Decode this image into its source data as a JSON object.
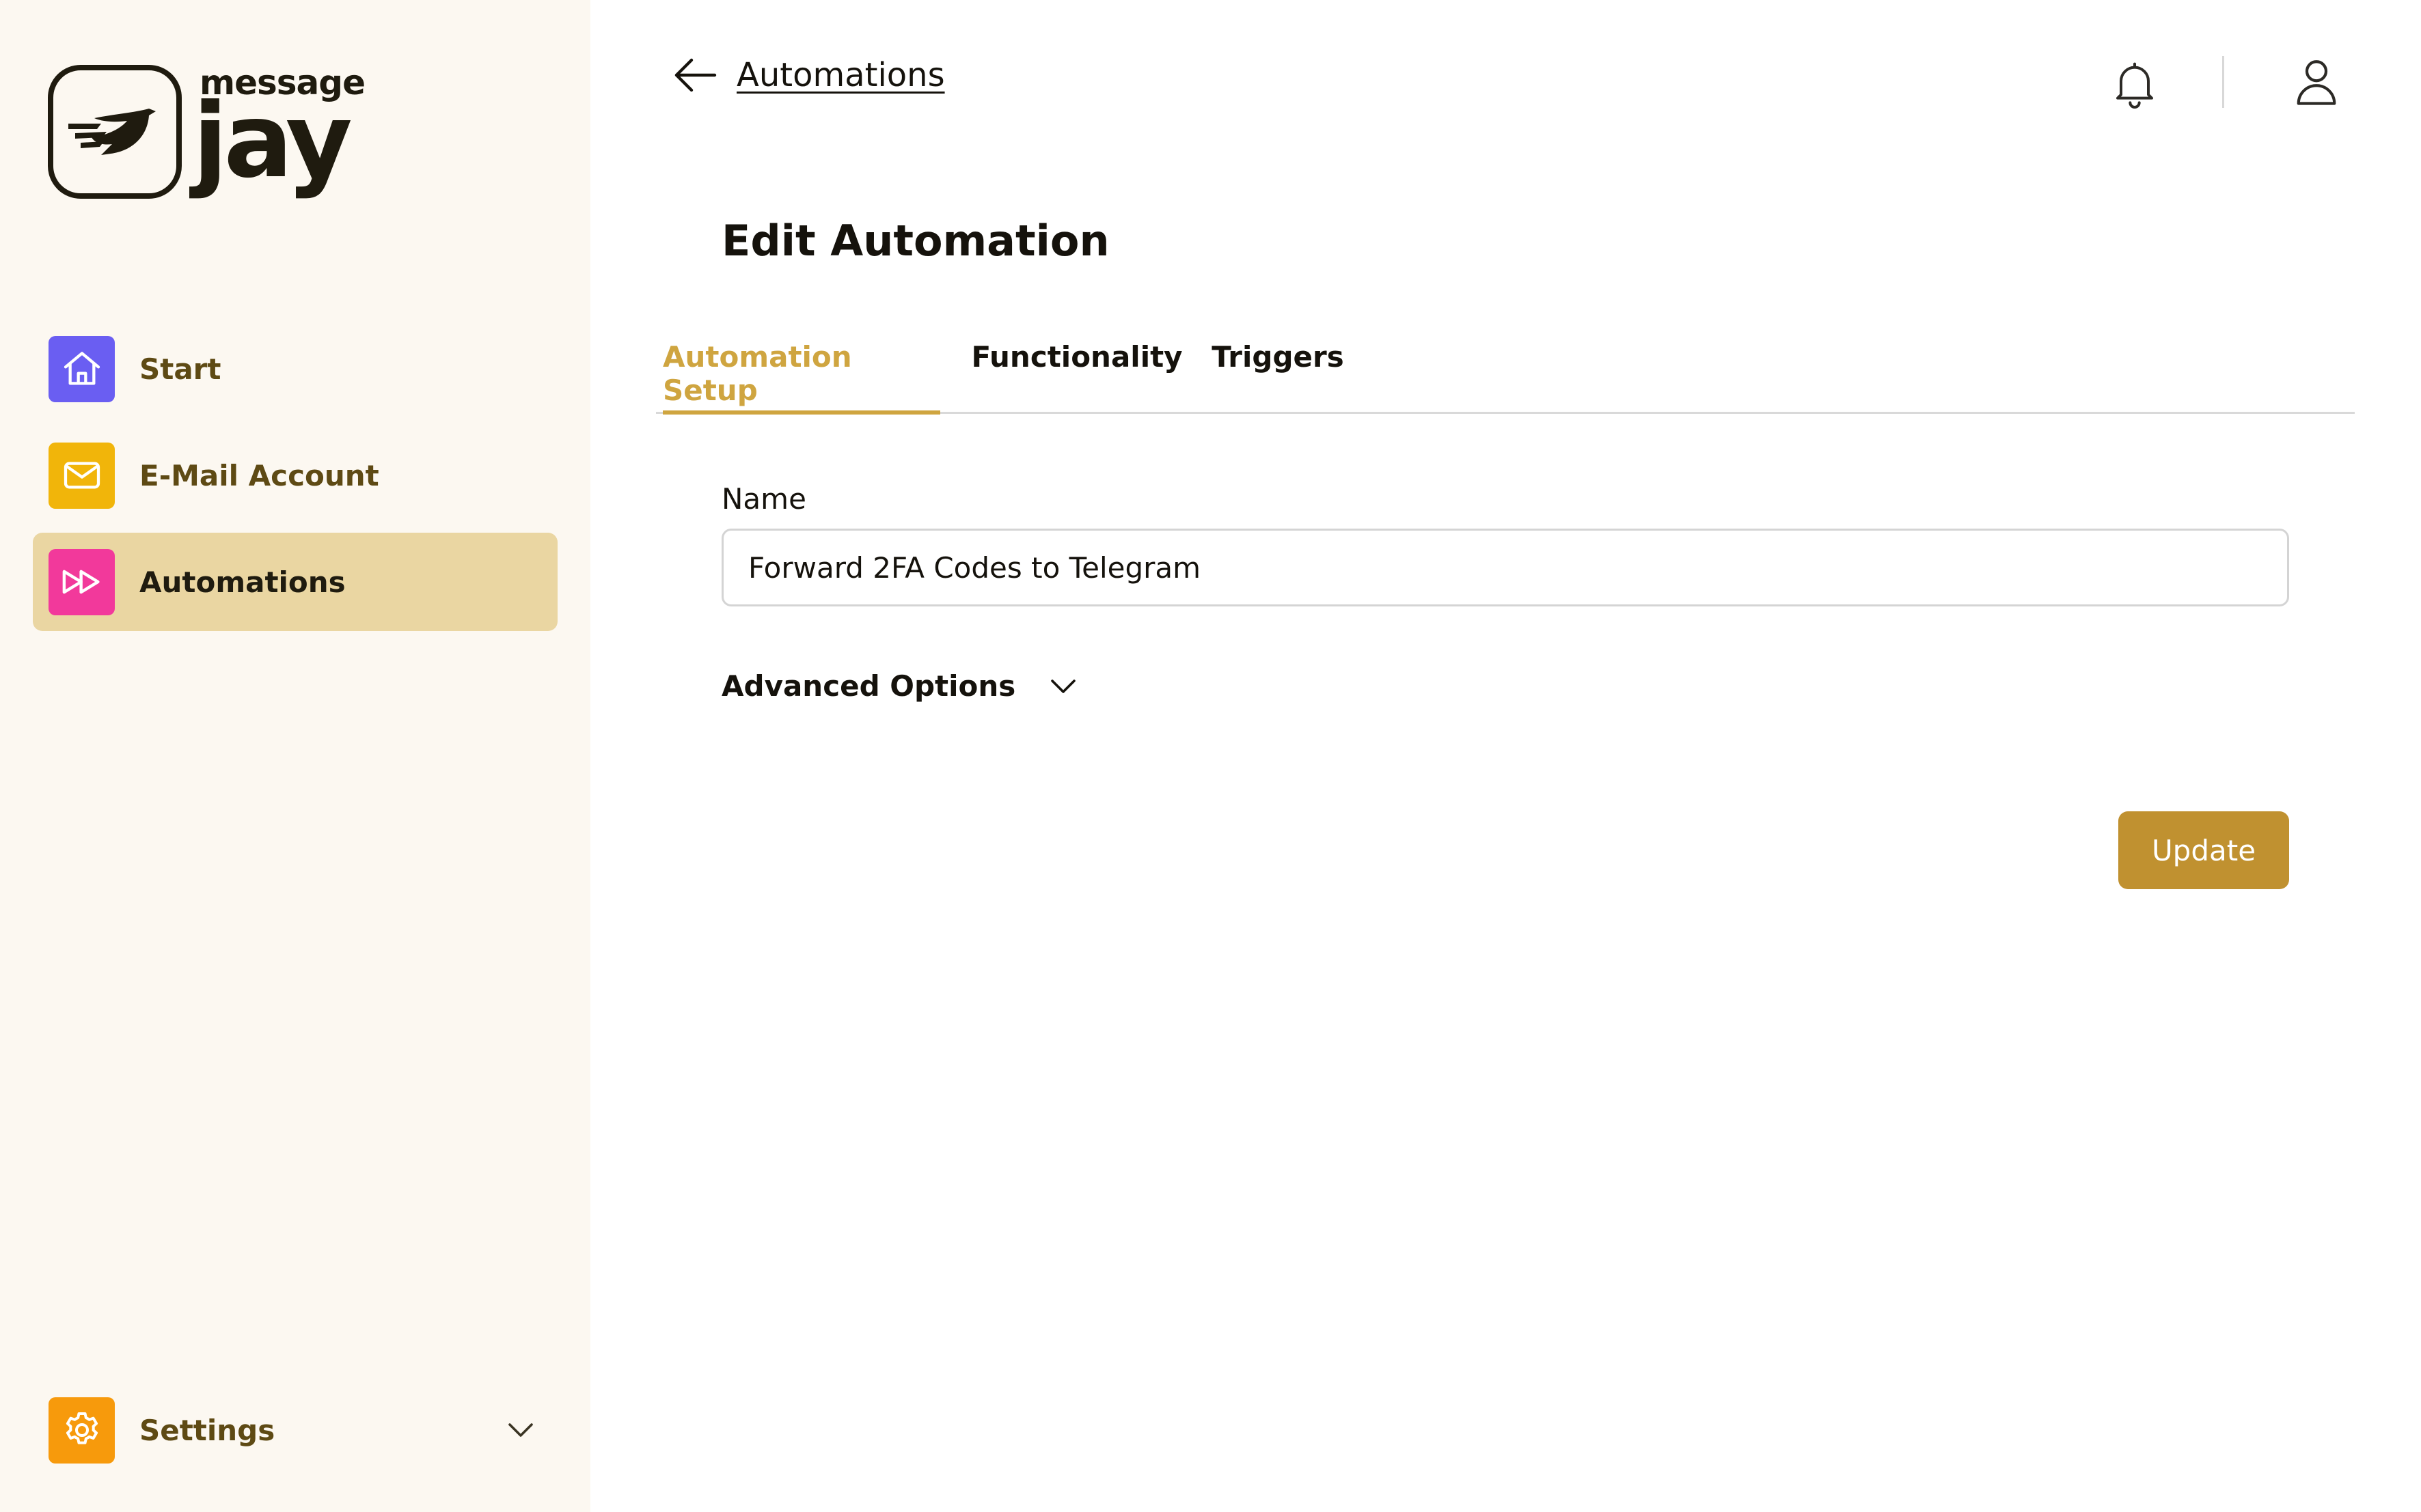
{
  "brand": {
    "name_small": "message",
    "name_big": "jay"
  },
  "sidebar": {
    "items": [
      {
        "label": "Start",
        "icon": "home-icon",
        "color": "#6a5ef2",
        "active": false
      },
      {
        "label": "E-Mail Account",
        "icon": "mail-icon",
        "color": "#f1b50a",
        "active": false
      },
      {
        "label": "Automations",
        "icon": "fast-forward-icon",
        "color": "#f2399b",
        "active": true
      }
    ],
    "settings": {
      "label": "Settings",
      "icon": "gear-icon",
      "color": "#f79a0c"
    }
  },
  "header": {
    "back_label": "Automations"
  },
  "page": {
    "title": "Edit Automation",
    "tabs": [
      {
        "label": "Automation Setup",
        "active": true
      },
      {
        "label": "Functionality",
        "active": false
      },
      {
        "label": "Triggers",
        "active": false
      }
    ],
    "name_label": "Name",
    "name_value": "Forward 2FA Codes to Telegram",
    "advanced_label": "Advanced Options",
    "update_label": "Update"
  },
  "colors": {
    "accent": "#cfa540",
    "button": "#c09130",
    "active_nav": "#ead6a2",
    "sidebar_bg": "#fcf8f1"
  }
}
